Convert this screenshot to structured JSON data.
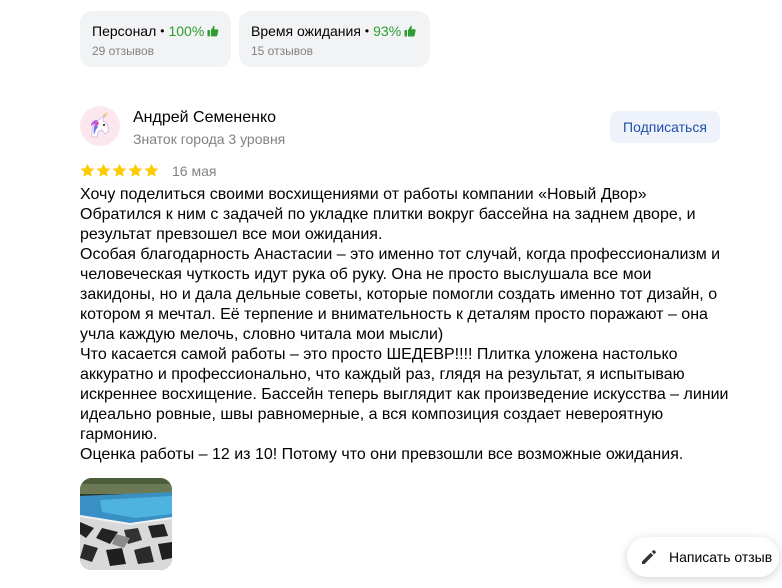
{
  "aspects": [
    {
      "name": "Персонал",
      "percent": "100%",
      "count": "29 отзывов",
      "icon": "thumbs-up-icon",
      "accent": "#2e9c2e"
    },
    {
      "name": "Время ожидания",
      "percent": "93%",
      "count": "15 отзывов",
      "icon": "thumbs-up-icon",
      "accent": "#2e9c2e"
    }
  ],
  "separator": "•",
  "review": {
    "author": {
      "name": "Андрей Семененко",
      "level": "Знаток города 3 уровня",
      "avatar_icon": "unicorn-avatar-icon"
    },
    "subscribe_label": "Подписаться",
    "rating": 5,
    "star_color": "#ffcc00",
    "date": "16 мая",
    "paragraphs": [
      "Хочу поделиться своими восхищениями от работы компании «Новый Двор» Обратился к ним с задачей по укладке плитки вокруг бассейна на заднем дворе, и результат превзошел все мои ожидания.",
      "Особая благодарность Анастасии – это именно тот случай, когда профессионализм и человеческая чуткость идут рука об руку. Она не просто выслушала все мои закидоны, но и дала дельные советы, которые помогли создать именно тот дизайн, о котором я мечтал. Её терпение и внимательность к деталям просто поражают – она учла каждую мелочь, словно читала мои мысли)",
      "Что касается самой работы – это просто ШЕДЕВР!!!! Плитка уложена настолько аккуратно и профессионально, что каждый раз, глядя на результат, я испытываю искреннее восхищение. Бассейн теперь выглядит как произведение искусства – линии идеально ровные, швы равномерные, а вся композиция создает невероятную гармонию.",
      "Оценка работы – 12 из 10! Потому что они превзошли все возможные ожидания."
    ],
    "photo_icon": "pool-photo-thumbnail"
  },
  "write_review_label": "Написать отзыв"
}
